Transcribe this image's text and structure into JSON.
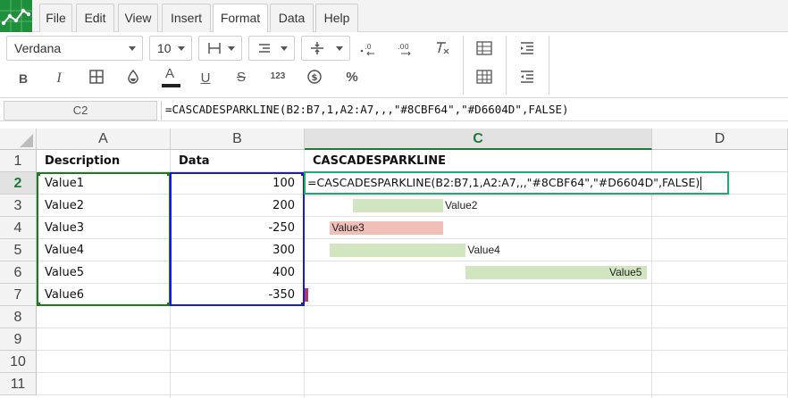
{
  "menu": {
    "items": [
      {
        "label": "File"
      },
      {
        "label": "Edit"
      },
      {
        "label": "View"
      },
      {
        "label": "Insert"
      },
      {
        "label": "Format"
      },
      {
        "label": "Data"
      },
      {
        "label": "Help"
      }
    ],
    "active": "Format"
  },
  "toolbar": {
    "font_family": "Verdana",
    "font_size": "10",
    "bold": "B",
    "italic": "I",
    "text_color": "A",
    "underline": "U",
    "strikethrough": "S",
    "number_format": "123",
    "currency": "$",
    "percent": "%"
  },
  "formula_bar": {
    "name_box": "C2",
    "formula": "=CASCADESPARKLINE(B2:B7,1,A2:A7,,,\"#8CBF64\",\"#D6604D\",FALSE)"
  },
  "grid": {
    "columns": [
      "A",
      "B",
      "C",
      "D"
    ],
    "selected_column": "C",
    "rows": [
      "1",
      "2",
      "3",
      "4",
      "5",
      "6",
      "7",
      "8",
      "9",
      "10",
      "11"
    ],
    "selected_row": "2",
    "headers": {
      "a1": "Description",
      "b1": "Data",
      "c1": "CASCADESPARKLINE"
    },
    "data": [
      {
        "description": "Value1",
        "value": "100"
      },
      {
        "description": "Value2",
        "value": "200"
      },
      {
        "description": "Value3",
        "value": "-250"
      },
      {
        "description": "Value4",
        "value": "300"
      },
      {
        "description": "Value5",
        "value": "400"
      },
      {
        "description": "Value6",
        "value": "-350"
      }
    ],
    "editor_text": "=CASCADESPARKLINE(B2:B7,1,A2:A7,,,\"#8CBF64\",\"#D6604D\",FALSE)"
  },
  "sparkline": {
    "positive_color": "#8CBF64",
    "negative_color": "#D6604D",
    "labels": [
      "Value2",
      "Value3",
      "Value4",
      "Value5"
    ]
  },
  "colors": {
    "brand": "#1E8F3A",
    "range_a": "#1E7A1E",
    "range_b": "#1A1AD6",
    "editor_border": "#2AA37A"
  }
}
